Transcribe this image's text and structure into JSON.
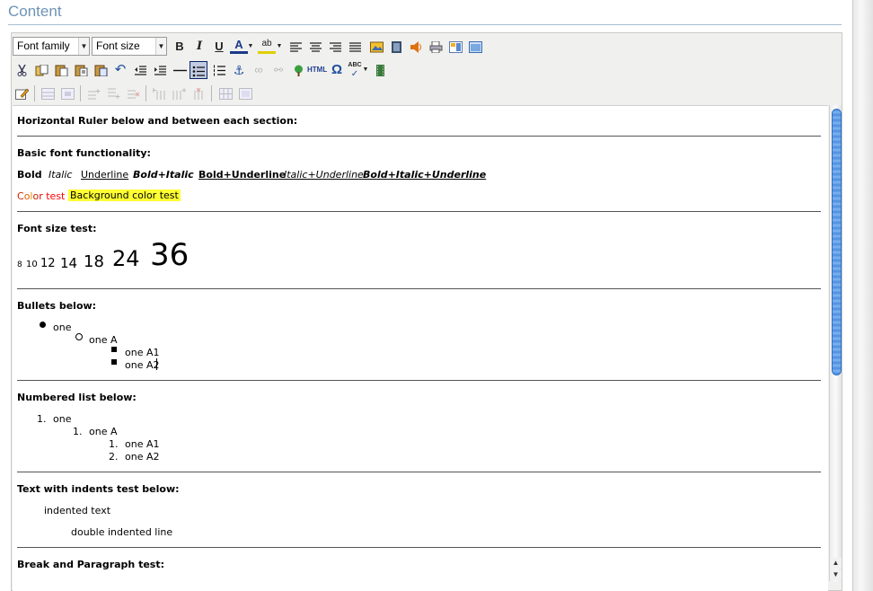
{
  "page": {
    "title": "Content"
  },
  "toolbar": {
    "font_family": "Font family",
    "font_size": "Font size",
    "bold": "B",
    "italic": "I",
    "underline": "U",
    "forecolor": "A",
    "backcolor": "ab",
    "html": "HTML",
    "omega": "Ω",
    "spell": "ABC"
  },
  "doc": {
    "hr_heading": "Horizontal Ruler below and between each section:",
    "font_heading": "Basic font functionality:",
    "bold": "Bold",
    "italic": "Italic",
    "underline": "Underline",
    "bold_italic": "Bold+Italic",
    "bold_underline": "Bold+Underline",
    "italic_underline": "Italic+Underline",
    "bold_italic_underline": "Bold+Italic+Underline",
    "color_test": [
      "C",
      "o",
      "l",
      "o",
      "r",
      " test"
    ],
    "bg_test": "Background color test",
    "size_heading": "Font size test:",
    "sizes": [
      "8",
      "10",
      "12",
      "14",
      "18",
      "24",
      "36"
    ],
    "bullets_heading": "Bullets below:",
    "bullets": [
      "one",
      "one A",
      "one A1",
      "one A2"
    ],
    "numbered_heading": "Numbered list below:",
    "numbered": [
      {
        "num": "1.",
        "text": "one"
      },
      {
        "num": "1.",
        "text": "one A"
      },
      {
        "num": "1.",
        "text": "one A1"
      },
      {
        "num": "2.",
        "text": "one A2"
      }
    ],
    "indent_heading": "Text with indents test below:",
    "indent1": "indented text",
    "indent2": "double indented line",
    "break_heading": "Break and Paragraph test:"
  },
  "colors": {
    "title": "#6d93b5",
    "highlight": "#ffff33",
    "color_test": [
      "#cc2200",
      "#e06000",
      "#f09000",
      "#c02000",
      "#e00000",
      "#ff0000"
    ]
  }
}
